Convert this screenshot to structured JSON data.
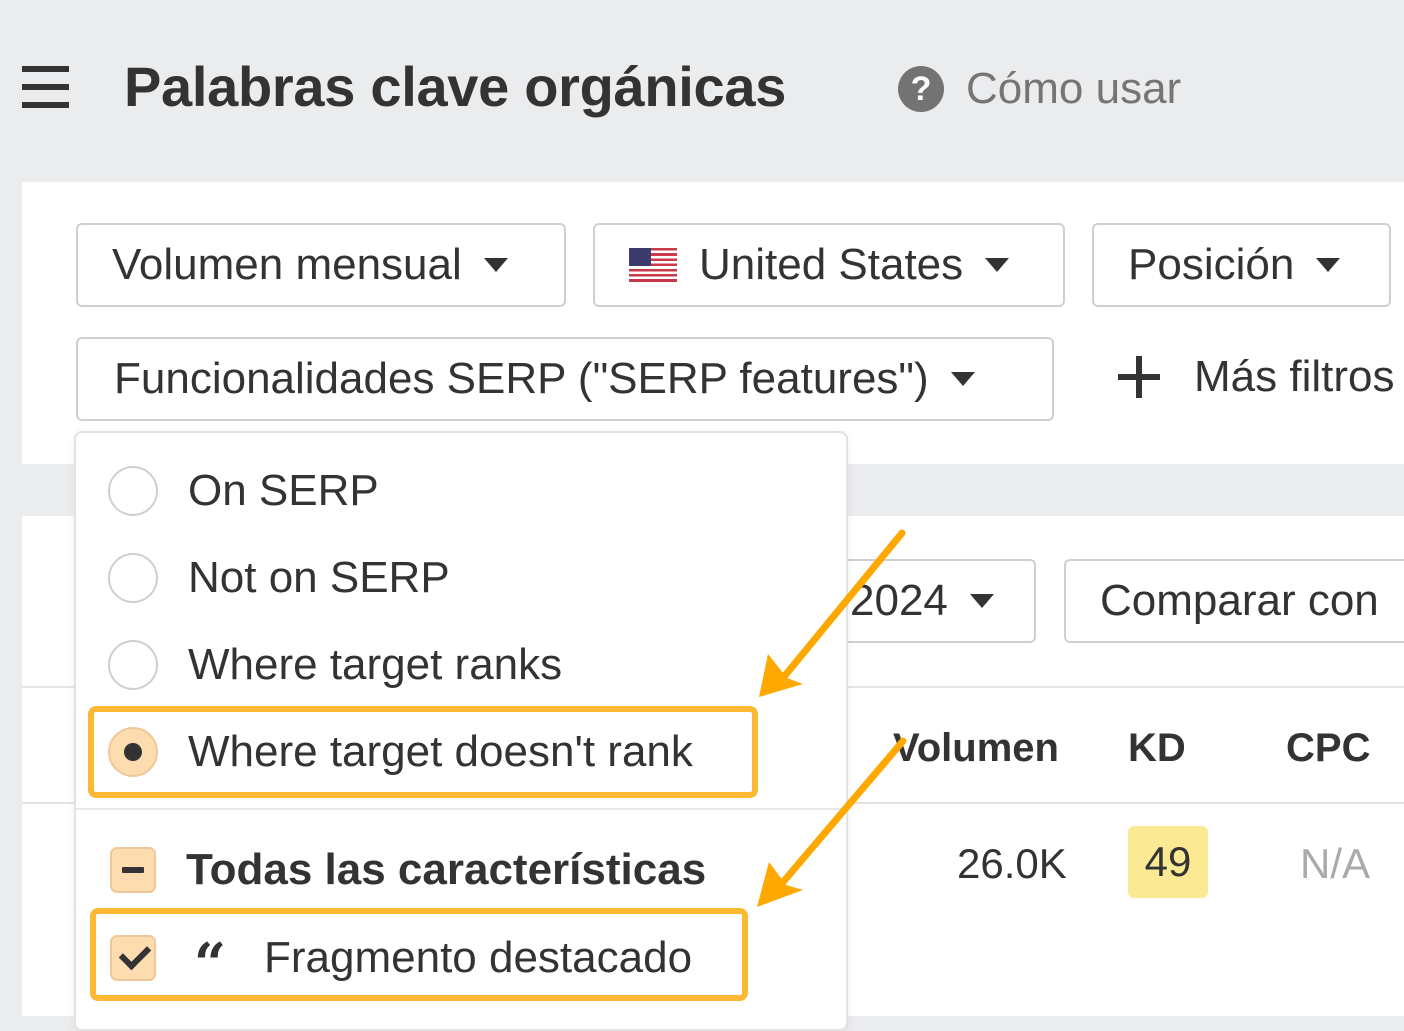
{
  "header": {
    "menu_icon": "hamburger-menu-icon",
    "title": "Palabras clave orgánicas",
    "help_icon": "question-circle-icon",
    "help_icon_glyph": "?",
    "help_label": "Cómo usar"
  },
  "filters": {
    "volume": {
      "label": "Volumen mensual",
      "icon": "caret-down-icon"
    },
    "country": {
      "label": "United States",
      "flag": "us-flag-icon",
      "icon": "caret-down-icon"
    },
    "position": {
      "label": "Posición",
      "icon": "caret-down-icon"
    },
    "serp_features": {
      "label": "Funcionalidades SERP (\"SERP features\")",
      "icon": "caret-down-icon"
    },
    "more_filters": {
      "label": "Más filtros",
      "icon": "plus-icon"
    }
  },
  "toolbar": {
    "date_select": {
      "label": "2024",
      "icon": "caret-down-icon"
    },
    "compare": {
      "label": "Comparar con"
    }
  },
  "table": {
    "columns": [
      "Volumen",
      "KD",
      "CPC"
    ],
    "rows": [
      {
        "volume": "26.0K",
        "kd": "49",
        "cpc": "N/A"
      }
    ]
  },
  "serp_dropdown": {
    "radio_options": [
      {
        "label": "On SERP",
        "selected": false
      },
      {
        "label": "Not on SERP",
        "selected": false
      },
      {
        "label": "Where target ranks",
        "selected": false
      },
      {
        "label": "Where target doesn't rank",
        "selected": true
      }
    ],
    "all_features": {
      "label": "Todas las características",
      "state": "indeterminate"
    },
    "features": [
      {
        "label": "Fragmento destacado",
        "icon": "quote-icon",
        "glyph": "❛❜",
        "checked": true
      }
    ]
  },
  "annotations": {
    "highlight_color": "#fdb933",
    "arrow_color": "#fea800"
  },
  "colors": {
    "page_bg": "#ebecee",
    "kd_badge": "#fce993",
    "selected_control": "#fddcb0",
    "muted_text": "#aaaaaa"
  }
}
